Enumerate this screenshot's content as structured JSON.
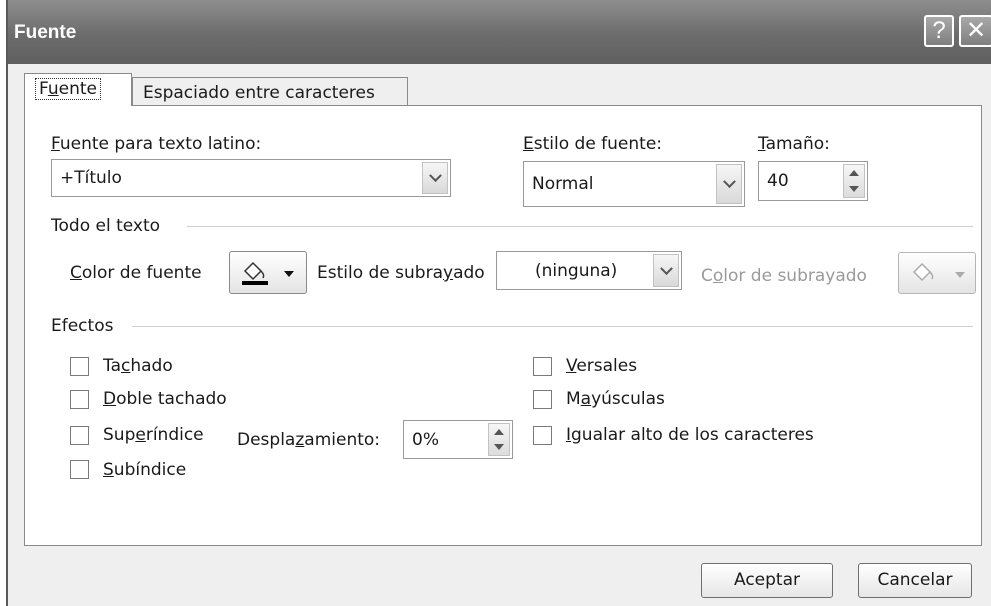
{
  "window": {
    "title": "Fuente",
    "help_glyph": "?",
    "close_glyph": "✕"
  },
  "tabs": [
    {
      "label": "Fuente",
      "active": true
    },
    {
      "label": "Espaciado entre caracteres",
      "active": false
    }
  ],
  "font": {
    "latin_label": "Fuente para texto latino:",
    "latin_value": "+Título",
    "style_label": "Estilo de fuente:",
    "style_value": "Normal",
    "size_label": "Tamaño:",
    "size_value": "40"
  },
  "all_text": {
    "section_label": "Todo el texto",
    "font_color_label": "Color de fuente",
    "underline_style_label": "Estilo de subrayado",
    "underline_style_value": "(ninguna)",
    "underline_color_label": "Color de subrayado"
  },
  "effects": {
    "section_label": "Efectos",
    "strikethrough": "Tachado",
    "double_strikethrough": "Doble tachado",
    "superscript": "Superíndice",
    "subscript": "Subíndice",
    "offset_label": "Desplazamiento:",
    "offset_value": "0%",
    "small_caps": "Versales",
    "all_caps": "Mayúsculas",
    "equalize_height": "Igualar alto de los caracteres"
  },
  "footer": {
    "ok_label": "Aceptar",
    "cancel_label": "Cancelar"
  },
  "colors": {
    "titlebar": "#6c6c6c",
    "font_color_swatch": "#000000"
  }
}
